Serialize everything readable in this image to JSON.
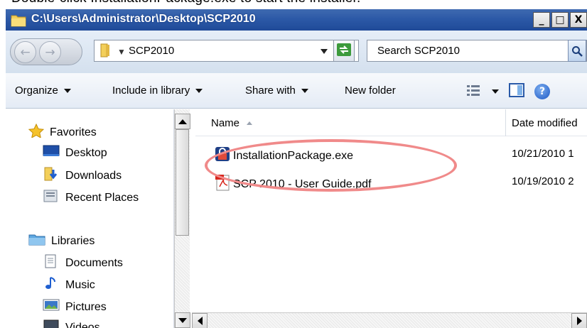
{
  "caption": "Double-click InstallationPackage.exe to start the installer.",
  "window": {
    "title": "C:\\Users\\Administrator\\Desktop\\SCP2010",
    "minimize": "_",
    "maximize": "□",
    "close": "X"
  },
  "address": {
    "crumb": "SCP2010",
    "search_placeholder": "Search SCP2010"
  },
  "toolbar": {
    "organize": "Organize",
    "include_in_library": "Include in library",
    "share_with": "Share with",
    "new_folder": "New folder",
    "help": "?"
  },
  "nav": {
    "favorites_header": "Favorites",
    "favorites": [
      "Desktop",
      "Downloads",
      "Recent Places"
    ],
    "libraries_header": "Libraries",
    "libraries": [
      "Documents",
      "Music",
      "Pictures",
      "Videos"
    ]
  },
  "columns": {
    "name": "Name",
    "date_modified": "Date modified"
  },
  "files": [
    {
      "name": "InstallationPackage.exe",
      "date": "10/21/2010 1",
      "icon": "installer-lock-icon"
    },
    {
      "name": "SCP 2010 - User Guide.pdf",
      "date": "10/19/2010 2",
      "icon": "pdf-icon"
    }
  ],
  "colors": {
    "title_bar": "#2c59a7",
    "highlight_ellipse": "#f08a8a"
  }
}
